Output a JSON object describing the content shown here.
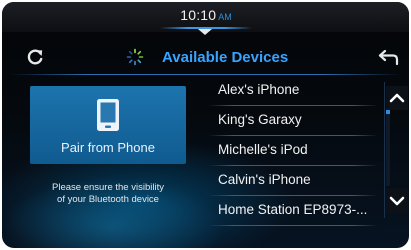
{
  "status_bar": {
    "time": "10:10",
    "ampm": "AM"
  },
  "header": {
    "title": "Available Devices",
    "refresh_icon": "refresh-icon",
    "back_icon": "back-arrow-icon",
    "spinner_icon": "loading-spinner-icon"
  },
  "pair_panel": {
    "button_label": "Pair from Phone",
    "icon": "smartphone-icon",
    "note_line1": "Please ensure the visibility",
    "note_line2": "of your Bluetooth device"
  },
  "devices": [
    {
      "label": "Alex's iPhone"
    },
    {
      "label": "King's Garaxy"
    },
    {
      "label": "Michelle's iPod"
    },
    {
      "label": "Calvin's iPhone"
    },
    {
      "label": "Home Station EP8973-..."
    }
  ],
  "scrollbar": {
    "up_icon": "chevron-up-icon",
    "down_icon": "chevron-down-icon"
  },
  "colors": {
    "accent": "#3aa3ff",
    "pair_button": "#1a6ca3",
    "background": "#05090e"
  }
}
